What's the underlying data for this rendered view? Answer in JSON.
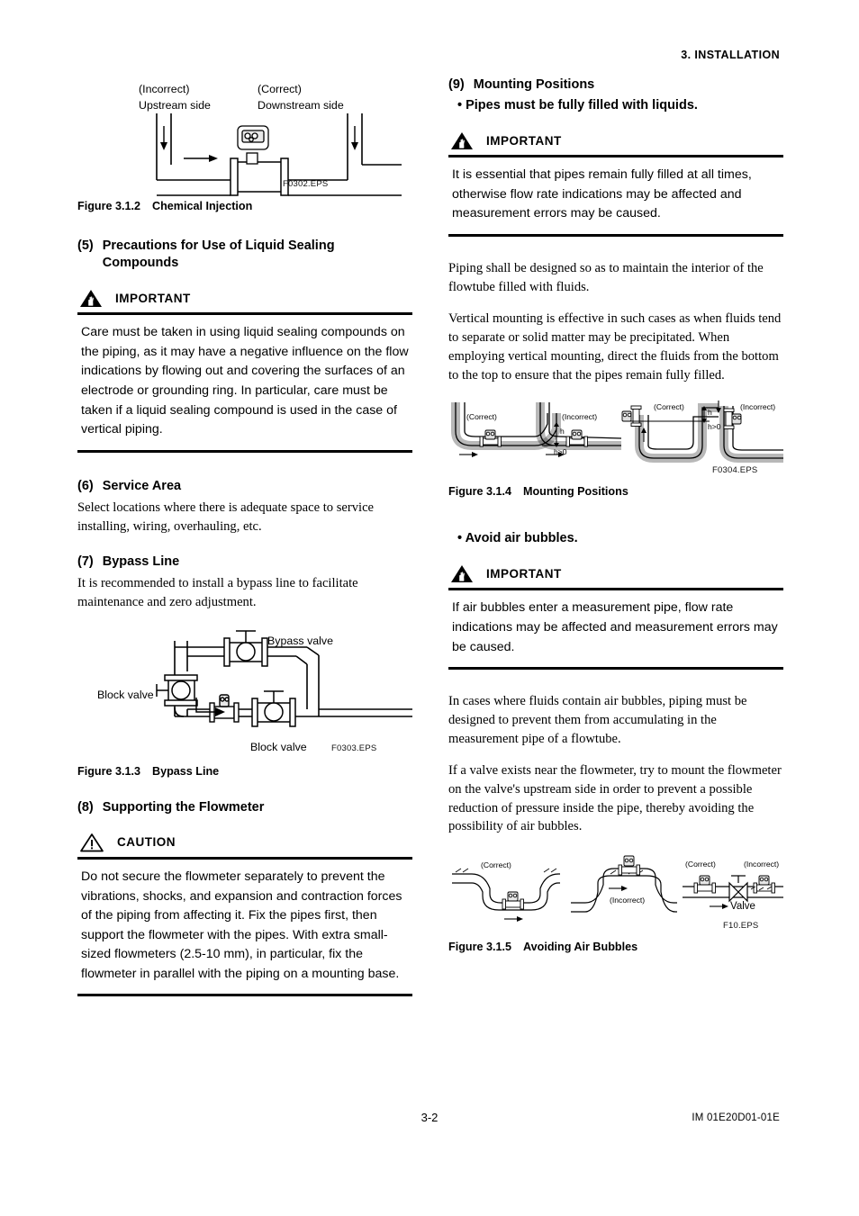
{
  "header": {
    "running_head": "3.  INSTALLATION"
  },
  "footer": {
    "page_number": "3-2",
    "doc_code": "IM 01E20D01-01E"
  },
  "left_column": {
    "figure_312": {
      "labels": {
        "incorrect": "(Incorrect)",
        "upstream": "Upstream side",
        "correct": "(Correct)",
        "downstream": "Downstream side"
      },
      "file_id": "F0302.EPS",
      "caption_num": "Figure 3.1.2",
      "caption_title": "Chemical Injection"
    },
    "section_5": {
      "num": "(5)",
      "title": "Precautions for Use of Liquid Sealing Compounds",
      "notice": {
        "type": "IMPORTANT",
        "icon": "important-triangle-hand-icon",
        "text": "Care must be taken in using liquid sealing compounds on the piping, as it may have a negative influence on the flow indications by flowing out and covering the surfaces of an electrode or grounding ring. In particular, care must be taken if a liquid sealing compound is used in the case of vertical piping."
      }
    },
    "section_6": {
      "num": "(6)",
      "title": "Service Area",
      "paragraph": "Select locations where there is adequate space to service installing, wiring, overhauling, etc."
    },
    "section_7": {
      "num": "(7)",
      "title": "Bypass Line",
      "paragraph": "It is recommended to install a bypass line to facilitate maintenance and zero adjustment.",
      "figure_313": {
        "labels": {
          "bypass_valve": "Bypass valve",
          "block_valve_left": "Block valve",
          "block_valve_bottom": "Block valve"
        },
        "file_id": "F0303.EPS",
        "caption_num": "Figure 3.1.3",
        "caption_title": "Bypass Line"
      }
    },
    "section_8": {
      "num": "(8)",
      "title": "Supporting the Flowmeter",
      "notice": {
        "type": "CAUTION",
        "icon": "caution-triangle-exclamation-icon",
        "text": "Do not secure the flowmeter separately to prevent the vibrations, shocks, and expansion and contraction forces of the piping from affecting it. Fix the pipes first, then support the flowmeter with the pipes. With extra small-sized flowmeters (2.5-10 mm), in particular, fix the flowmeter in parallel with the piping on a mounting base."
      }
    }
  },
  "right_column": {
    "section_9": {
      "num": "(9)",
      "title": "Mounting Positions",
      "bullet_1": "• Pipes must be fully filled with liquids.",
      "notice_1": {
        "type": "IMPORTANT",
        "icon": "important-triangle-hand-icon",
        "text": "It is essential that pipes remain fully filled at all times, otherwise flow rate indications may be affected and measurement errors may be caused."
      },
      "paragraph_1": "Piping shall be designed so as to maintain the interior of the flowtube filled with fluids.",
      "paragraph_2": "Vertical mounting is effective in such cases as when fluids tend to separate or solid matter may be precipitated. When employing vertical mounting, direct the fluids from the bottom to the top to ensure that the pipes remain fully filled.",
      "figure_314": {
        "labels": {
          "a_correct": "(Correct)",
          "a_h": "h",
          "a_h_gt_0": "h>0",
          "b_incorrect": "(Incorrect)",
          "c_correct": "(Correct)",
          "c_h": "h",
          "c_h_gt_0": "h>0",
          "d_incorrect": "(Incorrect)"
        },
        "file_id": "F0304.EPS",
        "caption_num": "Figure 3.1.4",
        "caption_title": "Mounting Positions"
      },
      "bullet_2": "• Avoid air bubbles.",
      "notice_2": {
        "type": "IMPORTANT",
        "icon": "important-triangle-hand-icon",
        "text": "If air bubbles enter a measurement pipe, flow rate indications may be affected and measurement errors may be caused."
      },
      "paragraph_3": "In cases where fluids contain air bubbles, piping must be designed to prevent them from accumulating in the measurement pipe of a flowtube.",
      "paragraph_4": "If a valve exists near the flowmeter, try to mount the flowmeter on the valve's upstream side in order to prevent a possible reduction of pressure inside the pipe, thereby avoiding the possibility of air bubbles.",
      "figure_315": {
        "labels": {
          "a_correct": "(Correct)",
          "b_incorrect": "(Incorrect)",
          "c_correct": "(Correct)",
          "c_incorrect": "(Incorrect)",
          "valve": "Valve"
        },
        "file_id": "F10.EPS",
        "caption_num": "Figure 3.1.5",
        "caption_title": "Avoiding Air Bubbles"
      }
    }
  }
}
